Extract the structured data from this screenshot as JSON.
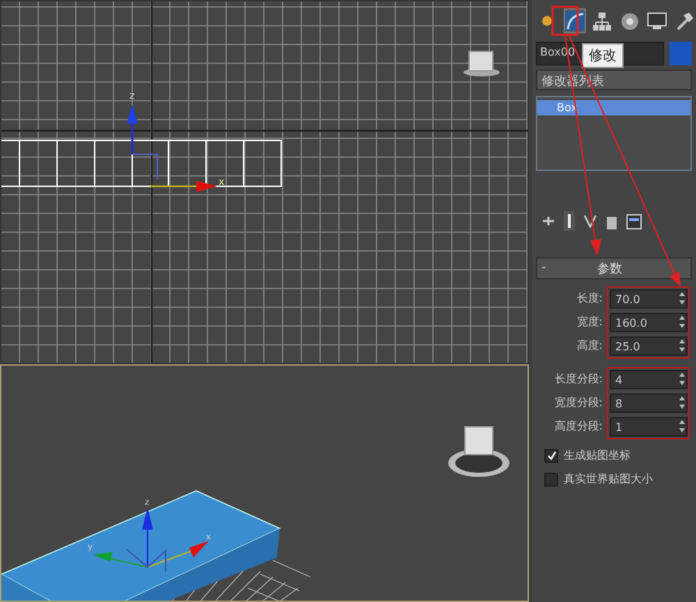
{
  "viewports": [
    {
      "kind": "top",
      "active": false,
      "gizmo_labels": [
        "z",
        "x"
      ]
    },
    {
      "kind": "perspective",
      "active": true,
      "gizmo_labels": [
        "z",
        "y",
        "x"
      ]
    }
  ],
  "command_tabs": [
    {
      "kind": "create",
      "selected": false
    },
    {
      "kind": "modify",
      "selected": true
    },
    {
      "kind": "hierarchy",
      "selected": false
    },
    {
      "kind": "motion",
      "selected": false
    },
    {
      "kind": "display",
      "selected": false
    },
    {
      "kind": "utilities",
      "selected": false
    }
  ],
  "tooltip": "修改",
  "object_name": "Box00",
  "modifier_list": "修改器列表",
  "stack": [
    {
      "label": "Box",
      "selected": true
    }
  ],
  "rollout": {
    "collapse": "-",
    "title": "参数",
    "dimension_fields": [
      {
        "label": "长度:",
        "value": "70.0"
      },
      {
        "label": "宽度:",
        "value": "160.0"
      },
      {
        "label": "高度:",
        "value": "25.0"
      }
    ],
    "segment_fields": [
      {
        "label": "长度分段:",
        "value": "4"
      },
      {
        "label": "宽度分段:",
        "value": "8"
      },
      {
        "label": "高度分段:",
        "value": "1"
      }
    ],
    "checkboxes": [
      {
        "label": "生成贴图坐标",
        "checked": true
      },
      {
        "label": "真实世界贴图大小",
        "checked": false
      }
    ]
  }
}
